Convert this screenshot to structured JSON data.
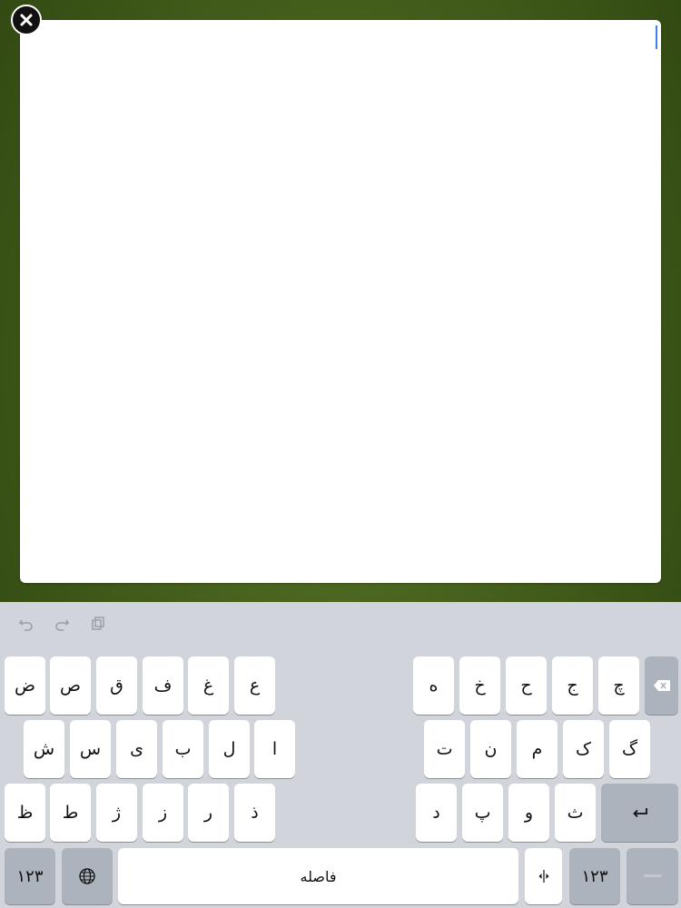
{
  "note": {
    "text": ""
  },
  "toolbar": {
    "undo_icon": "undo-icon",
    "redo_icon": "redo-icon",
    "paste_icon": "paste-icon"
  },
  "keyboard": {
    "row1_left": [
      "ض",
      "ص",
      "ق",
      "ف",
      "غ",
      "ع"
    ],
    "row1_right": [
      "ه",
      "خ",
      "ح",
      "ج",
      "چ"
    ],
    "row2_left": [
      "ش",
      "س",
      "ی",
      "ب",
      "ل",
      "ا"
    ],
    "row2_right": [
      "ت",
      "ن",
      "م",
      "ک",
      "گ"
    ],
    "row3_left": [
      "ظ",
      "ط",
      "ژ",
      "ز",
      "ر",
      "ذ"
    ],
    "row3_right": [
      "د",
      "پ",
      "و",
      "ث"
    ],
    "numbers_label": "۱۲۳",
    "space_label": "فاصله",
    "return_icon": "return-icon",
    "backspace_icon": "backspace-icon",
    "globe_icon": "globe-icon",
    "split_icon": "split-keyboard-icon",
    "dismiss_icon": "dismiss-keyboard-icon"
  }
}
